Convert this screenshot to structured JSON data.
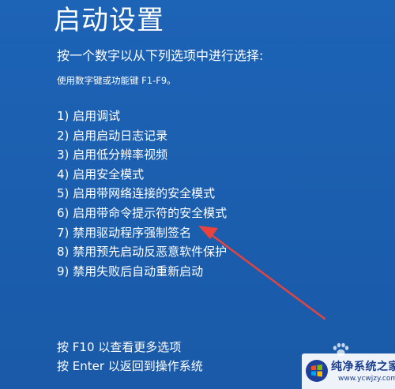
{
  "screen": {
    "title": "启动设置",
    "prompt": "按一个数字以从下列选项中进行选择:",
    "hint": "使用数字键或功能键 F1-F9。",
    "options": [
      "1) 启用调试",
      "2) 启用启动日志记录",
      "3) 启用低分辨率视频",
      "4) 启用安全模式",
      "5) 启用带网络连接的安全模式",
      "6) 启用带命令提示符的安全模式",
      "7) 禁用驱动程序强制签名",
      "8) 禁用预先启动反恶意软件保护",
      "9) 禁用失败后自动重新启动"
    ],
    "footer": {
      "more_options": "按 F10 以查看更多选项",
      "return_os": "按 Enter 以返回到操作系统"
    }
  },
  "annotation": {
    "arrow_color": "#e8433f",
    "points_to_option": 7
  },
  "watermark": {
    "site_name": "纯净系统之家",
    "url": "www.ycwjzy.com",
    "icon": "windows-logo-icon"
  },
  "colors": {
    "background": "#1b5fb2",
    "text": "#ffffff"
  }
}
